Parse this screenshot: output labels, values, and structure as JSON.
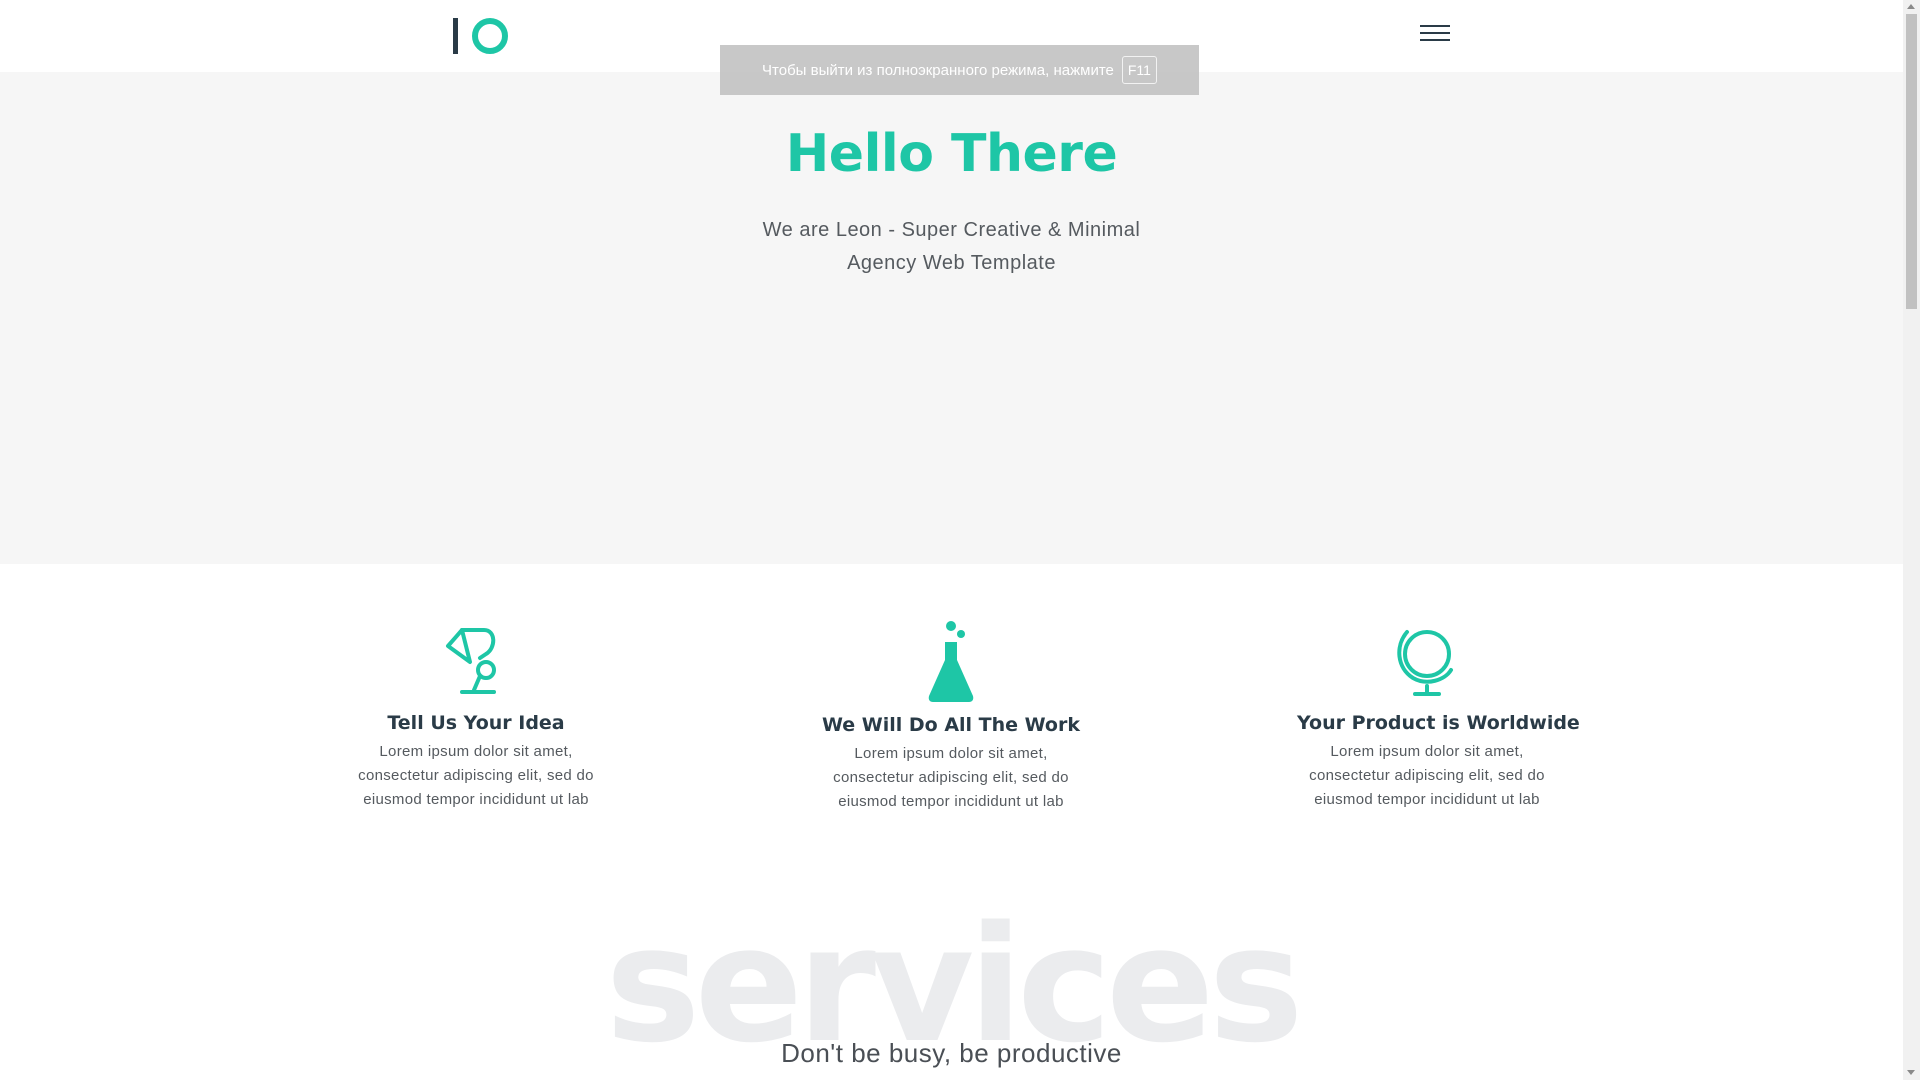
{
  "header": {
    "logo": {
      "icon": "io-logo-icon",
      "colors": {
        "bar": "#2a3b47",
        "ring": "#1ec6a6"
      }
    },
    "menu_icon": "hamburger-menu-icon"
  },
  "fullscreen_notice": {
    "text": "Чтобы выйти из полноэкранного режима, нажмите",
    "key": "F11"
  },
  "hero": {
    "title": "Hello There",
    "subtitle_line1": "We are Leon - Super Creative & Minimal",
    "subtitle_line2": "Agency Web Template"
  },
  "features": [
    {
      "icon": "desk-lamp-icon",
      "title": "Tell Us Your Idea",
      "text": "Lorem ipsum dolor sit amet, consectetur adipiscing elit, sed do eiusmod tempor incididunt ut lab"
    },
    {
      "icon": "flask-icon",
      "title": "We Will Do All The Work",
      "text": "Lorem ipsum dolor sit amet, consectetur adipiscing elit, sed do eiusmod tempor incididunt ut lab"
    },
    {
      "icon": "globe-icon",
      "title": "Your Product is Worldwide",
      "text": "Lorem ipsum dolor sit amet, consectetur adipiscing elit, sed do eiusmod tempor incididunt ut lab"
    }
  ],
  "services": {
    "background_word": "services",
    "subtitle": "Don't be busy, be productive"
  },
  "colors": {
    "accent": "#1ec6a6",
    "heading": "#2a3b47",
    "text": "#555a5f",
    "hero_bg": "#f6f6f6"
  }
}
